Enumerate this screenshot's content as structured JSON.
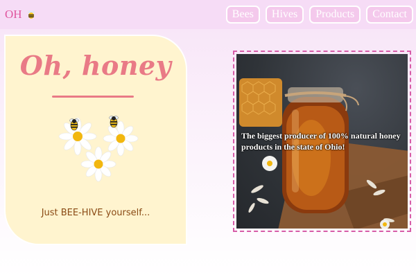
{
  "header": {
    "logo_text": "OH",
    "logo_icon": "bee-icon",
    "nav": [
      {
        "label": "Bees"
      },
      {
        "label": "Hives"
      },
      {
        "label": "Products"
      },
      {
        "label": "Contact"
      }
    ]
  },
  "hero": {
    "title": "Oh, honey",
    "tagline": "Just BEE-HIVE yourself..."
  },
  "feature": {
    "caption": "The biggest producer of 100% natural honey products in the state of Ohio!"
  },
  "colors": {
    "accent_pink": "#e0559e",
    "title_coral": "#e97a86",
    "card_cream": "#fff4cf",
    "nav_bg": "#f4c9ec",
    "header_bg": "#f6dcf6",
    "tagline_brown": "#8a4a14"
  }
}
